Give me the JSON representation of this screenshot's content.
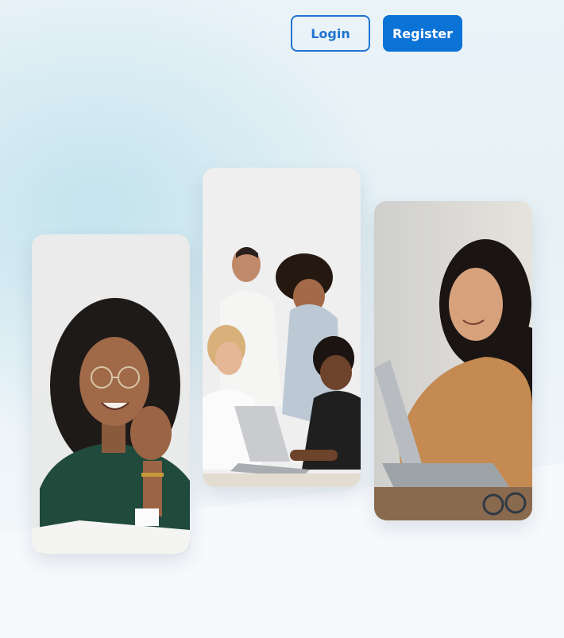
{
  "header": {
    "login_label": "Login",
    "register_label": "Register"
  },
  "colors": {
    "primary": "#0c73d6",
    "background": "#f7f9fc",
    "hero_tint": "#e6f1f6"
  },
  "gallery": [
    {
      "subject": "woman-with-glasses-smiling"
    },
    {
      "subject": "team-around-laptop"
    },
    {
      "subject": "woman-using-laptop"
    }
  ]
}
